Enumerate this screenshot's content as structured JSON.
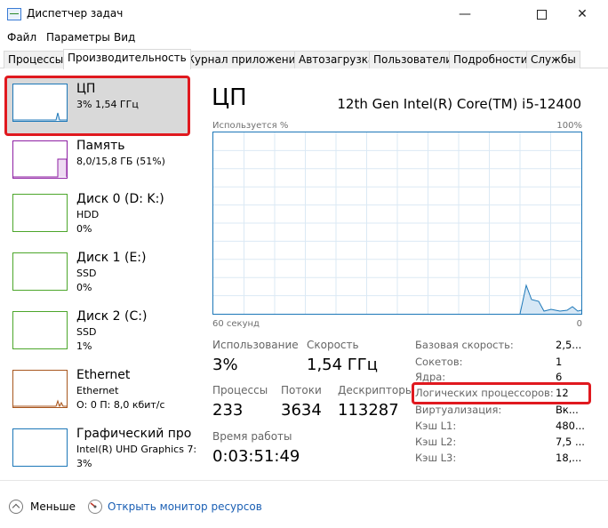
{
  "window": {
    "title": "Диспетчер задач",
    "controls": {
      "minimize": "—",
      "maximize": "",
      "close": "✕"
    }
  },
  "menu": [
    "Файл",
    "Параметры",
    "Вид"
  ],
  "tabs": [
    "Процессы",
    "Производительность",
    "Журнал приложений",
    "Автозагрузка",
    "Пользователи",
    "Подробности",
    "Службы"
  ],
  "active_tab": "Производительность",
  "sidebar": {
    "items": [
      {
        "name": "ЦП",
        "sub1": "3% 1,54 ГГц",
        "sub2": "",
        "color": "#1c77b8"
      },
      {
        "name": "Память",
        "sub1": "8,0/15,8 ГБ (51%)",
        "sub2": "",
        "color": "#8e1fa3"
      },
      {
        "name": "Диск 0 (D: K:)",
        "sub1": "HDD",
        "sub2": "0%",
        "color": "#4ca62b"
      },
      {
        "name": "Диск 1 (E:)",
        "sub1": "SSD",
        "sub2": "0%",
        "color": "#4ca62b"
      },
      {
        "name": "Диск 2 (C:)",
        "sub1": "SSD",
        "sub2": "1%",
        "color": "#4ca62b"
      },
      {
        "name": "Ethernet",
        "sub1": "Ethernet",
        "sub2": "О: 0 П: 8,0 кбит/с",
        "color": "#a8561d"
      },
      {
        "name": "Графический про",
        "sub1": "Intel(R) UHD Graphics 7:",
        "sub2": "3%",
        "color": "#1c77b8"
      }
    ]
  },
  "main": {
    "title": "ЦП",
    "model": "12th Gen Intel(R) Core(TM) i5-12400",
    "graph": {
      "label_top_left": "Используется %",
      "label_top_right": "100%",
      "label_bottom_left": "60 секунд",
      "label_bottom_right": "0"
    },
    "stats": {
      "usage_label": "Использование",
      "usage_value": "3%",
      "speed_label": "Скорость",
      "speed_value": "1,54 ГГц",
      "processes_label": "Процессы",
      "processes_value": "233",
      "threads_label": "Потоки",
      "threads_value": "3634",
      "handles_label": "Дескрипторы",
      "handles_value": "113287",
      "uptime_label": "Время работы",
      "uptime_value": "0:03:51:49"
    },
    "info": [
      {
        "k": "Базовая скорость:",
        "v": "2,5..."
      },
      {
        "k": "Сокетов:",
        "v": "1"
      },
      {
        "k": "Ядра:",
        "v": "6"
      },
      {
        "k": "Логических процессоров:",
        "v": "12"
      },
      {
        "k": "Виртуализация:",
        "v": "Вк..."
      },
      {
        "k": "Кэш L1:",
        "v": "480..."
      },
      {
        "k": "Кэш L2:",
        "v": "7,5 ..."
      },
      {
        "k": "Кэш L3:",
        "v": "18,..."
      }
    ]
  },
  "footer": {
    "fewer_label": "Меньше",
    "resource_monitor_label": "Открыть монитор ресурсов"
  },
  "colors": {
    "highlight": "#e0191f",
    "cpu": "#1c77b8",
    "link": "#1a5fb4"
  }
}
